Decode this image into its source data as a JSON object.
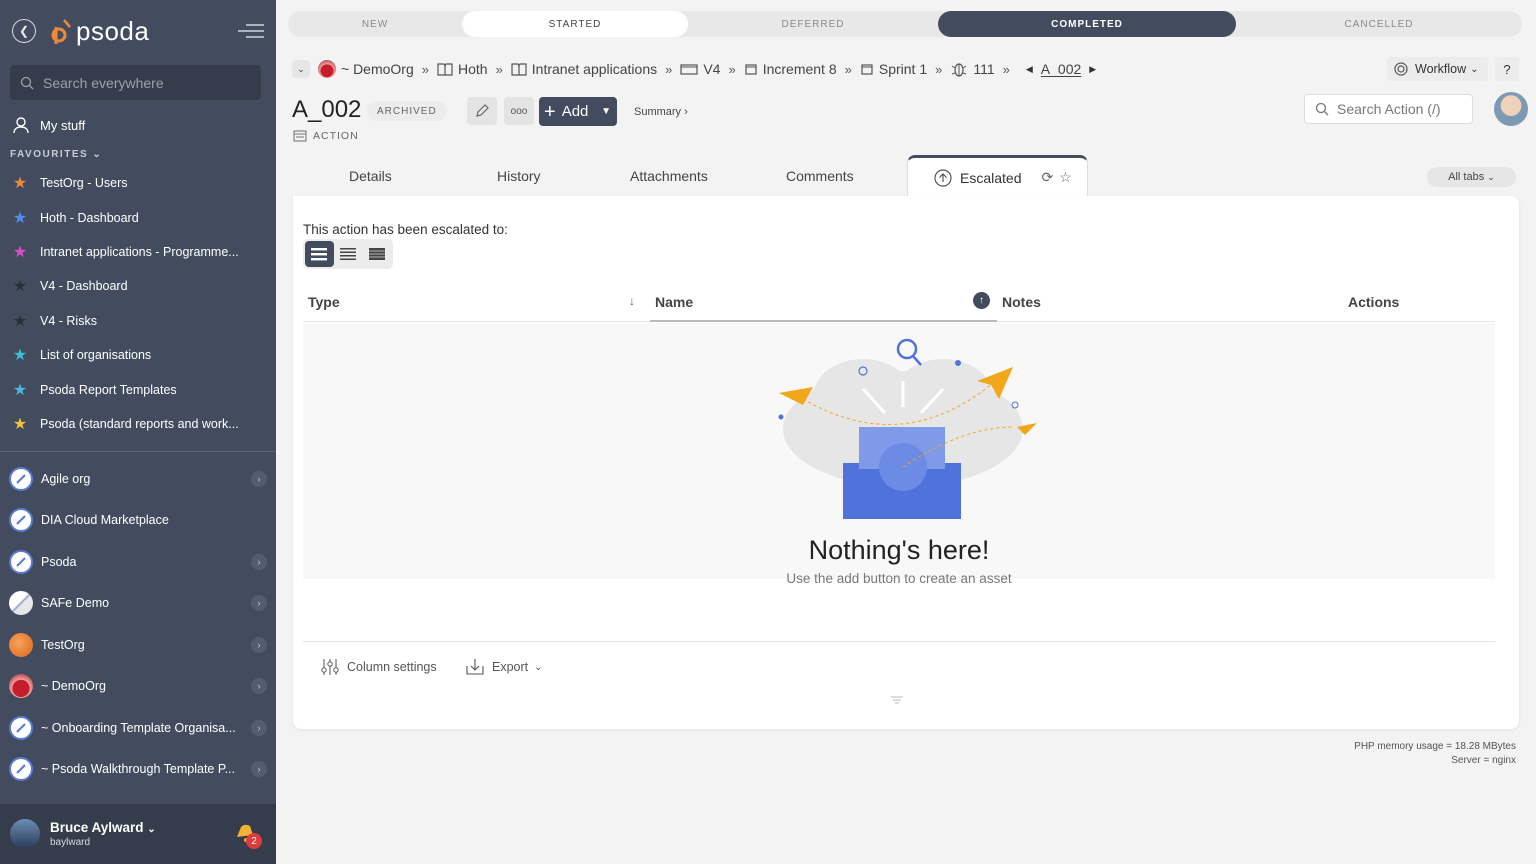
{
  "sidebar": {
    "logo": "psoda",
    "search_placeholder": "Search everywhere",
    "my_stuff": "My stuff",
    "favourites_header": "FAVOURITES",
    "favourites": [
      {
        "label": "TestOrg - Users",
        "color": "#f0883a"
      },
      {
        "label": "Hoth - Dashboard",
        "color": "#4b8ff0"
      },
      {
        "label": "Intranet applications - Programme...",
        "color": "#d84bd0"
      },
      {
        "label": "V4 - Dashboard",
        "color": "#2b2f38"
      },
      {
        "label": "V4 - Risks",
        "color": "#2b2f38"
      },
      {
        "label": "List of organisations",
        "color": "#3bbfd6"
      },
      {
        "label": "Psoda Report Templates",
        "color": "#4ab5e6"
      },
      {
        "label": "Psoda (standard reports and work...",
        "color": "#f0c13a"
      }
    ],
    "orgs": [
      {
        "label": "Agile org",
        "icon": "psoda"
      },
      {
        "label": "DIA Cloud Marketplace",
        "icon": "psoda"
      },
      {
        "label": "Psoda",
        "icon": "psoda"
      },
      {
        "label": "SAFe Demo",
        "icon": "safe"
      },
      {
        "label": "TestOrg",
        "icon": "orange"
      },
      {
        "label": "~ DemoOrg",
        "icon": "red"
      },
      {
        "label": "~ Onboarding Template Organisa...",
        "icon": "psoda"
      },
      {
        "label": "~ Psoda Walkthrough Template P...",
        "icon": "psoda"
      }
    ],
    "user_name": "Bruce Aylward",
    "user_handle": "baylward",
    "notification_count": "2"
  },
  "status_bar": [
    "NEW",
    "STARTED",
    "DEFERRED",
    "COMPLETED",
    "CANCELLED"
  ],
  "breadcrumb": {
    "org": "~ DemoOrg",
    "items": [
      "Hoth",
      "Intranet applications",
      "V4",
      "Increment 8",
      "Sprint 1",
      "111"
    ],
    "current": "A_002"
  },
  "header": {
    "workflow_label": "Workflow",
    "help_label": "?",
    "title": "A_002",
    "badge": "ARCHIVED",
    "subtype": "ACTION",
    "more_label": "ooo",
    "add_label": "Add",
    "summary_label": "Summary ›",
    "search_placeholder": "Search Action (/)"
  },
  "tabs": {
    "details": "Details",
    "history": "History",
    "attachments": "Attachments",
    "comments": "Comments",
    "escalated": "Escalated",
    "all_tabs": "All tabs"
  },
  "panel": {
    "intro": "This action has been escalated to:",
    "columns": {
      "type": "Type",
      "name": "Name",
      "notes": "Notes",
      "actions": "Actions"
    },
    "empty_title": "Nothing's here!",
    "empty_sub": "Use the add button to create an asset",
    "column_settings": "Column settings",
    "export": "Export"
  },
  "footer": {
    "memory": "PHP memory usage = 18.28 MBytes",
    "server": "Server = nginx"
  }
}
